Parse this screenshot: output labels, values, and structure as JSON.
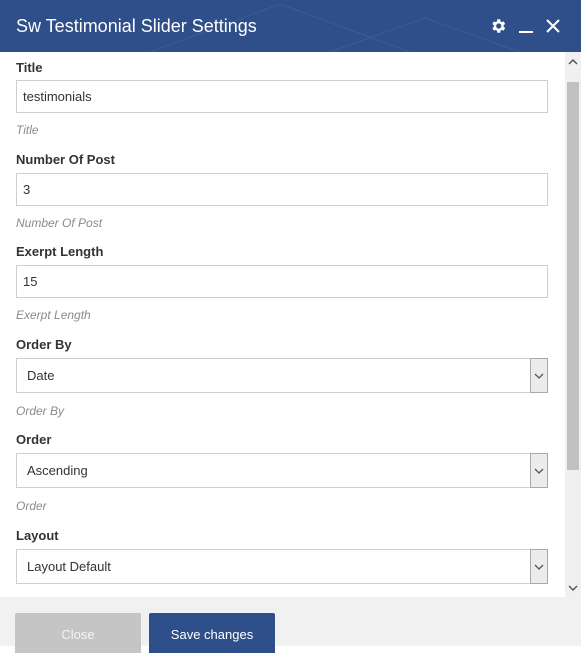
{
  "dialog": {
    "title": "Sw Testimonial Slider Settings",
    "header_color": "#2f4f8b",
    "header_icons": [
      "gear-icon",
      "minimize-icon",
      "close-icon"
    ]
  },
  "fields": {
    "title": {
      "label": "Title",
      "value": "testimonials",
      "hint": "Title"
    },
    "number_of_post": {
      "label": "Number Of Post",
      "value": "3",
      "hint": "Number Of Post"
    },
    "exerpt_length": {
      "label": "Exerpt Length",
      "value": "15",
      "hint": "Exerpt Length"
    },
    "order_by": {
      "label": "Order By",
      "value": "Date",
      "hint": "Order By"
    },
    "order": {
      "label": "Order",
      "value": "Ascending",
      "hint": "Order"
    },
    "layout": {
      "label": "Layout",
      "value": "Layout Default"
    }
  },
  "footer": {
    "close_label": "Close",
    "save_label": "Save changes"
  }
}
